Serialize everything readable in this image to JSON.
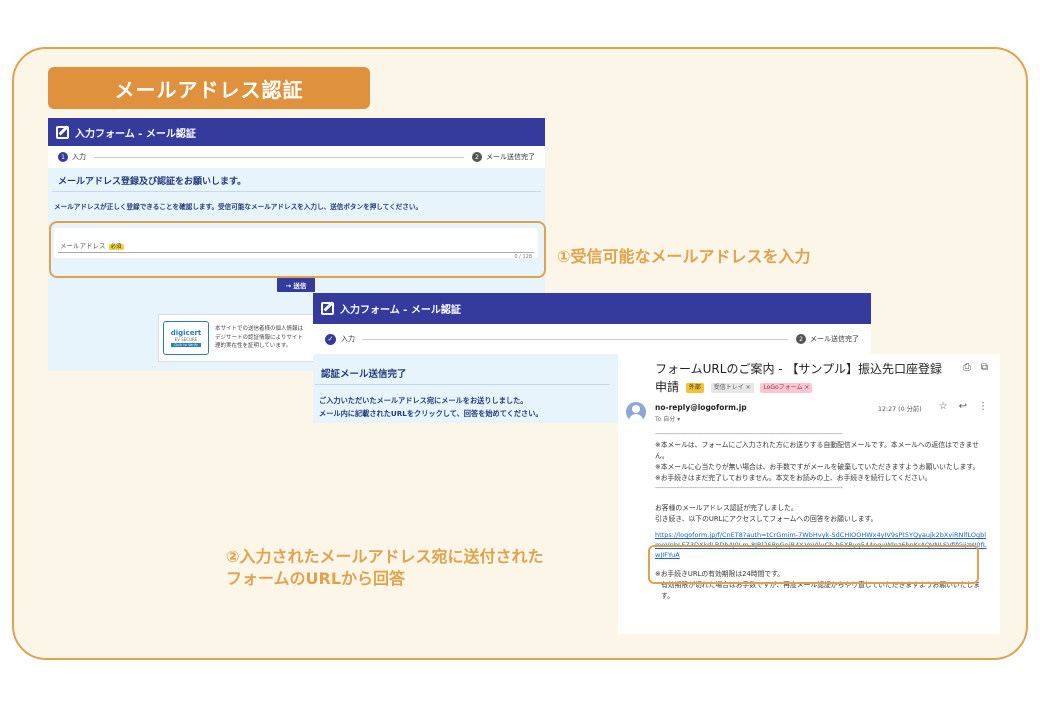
{
  "slide_title": "メールアドレス認証",
  "form1": {
    "header": "入力フォーム - メール認証",
    "step1_num": "1",
    "step1_label": "入力",
    "step2_num": "2",
    "step2_label": "メール送信完了",
    "section_title": "メールアドレス登録及び認証をお願いします。",
    "instruction": "メールアドレスが正しく登録できることを確認します。受信可能なメールアドレスを入力し、送信ボタンを押してください。",
    "field_label": "メールアドレス",
    "required_badge": "必須",
    "char_count": "0 / 128",
    "send_button": "→ 送信",
    "digicert": {
      "name": "digicert",
      "sub": "EV SECURE",
      "btn": "Click to Verify",
      "text_line1": "本サイトでの送信者様の個人情報は",
      "text_line2": "デジサートの認証情報によりサイト",
      "text_line3": "理的実在性を証明しています。"
    }
  },
  "form2": {
    "header": "入力フォーム - メール認証",
    "step1_label": "入力",
    "step2_num": "2",
    "step2_label": "メール送信完了",
    "section_title": "認証メール送信完了",
    "line1": "ご入力いただいたメールアドレス宛にメールをお送りしました。",
    "line2": "メール内に記載されたURLをクリックして、回答を始めてください。"
  },
  "email": {
    "subject_line1": "フォームURLのご案内 - 【サンプル】振込先口座登録",
    "subject_line2": "申請",
    "tag_external": "外部",
    "tag_inbox": "受信トレイ ×",
    "tag_logo": "LoGoフォーム ×",
    "sender": "no-reply@logoform.jp",
    "to": "To 自分 ▾",
    "time": "12:27 (0 分前)",
    "dashes": "------------------------------------------------------------------------------------------------",
    "notice1": "※本メールは、フォームにご入力された方にお送りする自動配信メールです。本メールへの返信はできません。",
    "notice2": "※本メールに心当たりが無い場合は、お手数ですがメールを破棄していただきますようお願いいたします。",
    "notice3": "※お手続きはまだ完了しておりません。本文をお読みの上、お手続きを続行してください。",
    "body1": "お客様のメールアドレス認証が完了しました。",
    "body2": "引き続き、以下のURLにアクセスしてフォームへの回答をお願いします。",
    "url": "https://logoform.jp/f/CnET8?auth=tCrGmim-7WbHvyk-SdCHIOOHWx4yIV9sPt5YQyaujk2bXviRNlfLOgblmoVnbLFZ3DXkdLBDb4J0Lm-8JBl2SPpGnjR4Y-VoVIluCh-b5XByg544nguWlnz6bnKrAQVNLSVfifGijzW0fLwJIFYuA",
    "expiry1": "※お手続きURLの有効期限は24時間です。",
    "expiry2": "有効期限が切れた場合はお手数ですが、再度メール認証からやり直していただきますようお願いいたします。"
  },
  "callouts": {
    "callout1": "①受信可能なメールアドレスを入力",
    "callout2_line1": "②入力されたメールアドレス宛に送付された",
    "callout2_line2": "フォームのURLから回答"
  },
  "colors": {
    "accent_orange": "#df913d",
    "form_header": "#343b9d",
    "panel_bg": "#fcf6e9"
  }
}
